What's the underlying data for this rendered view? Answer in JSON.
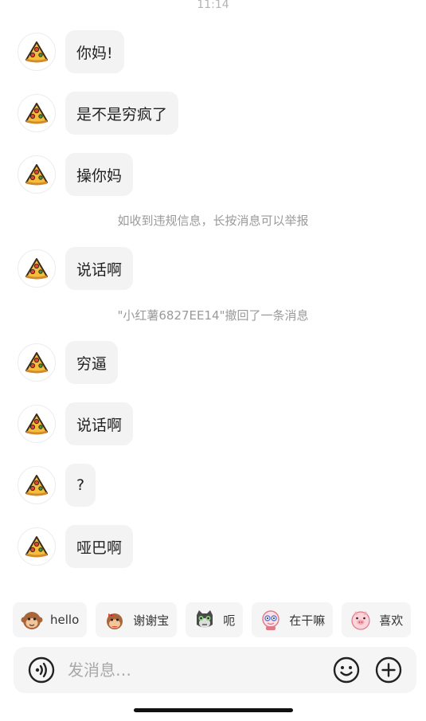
{
  "time": "11:14",
  "messages": [
    {
      "text": "你妈!"
    },
    {
      "text": "是不是穷疯了"
    },
    {
      "text": "操你妈"
    },
    {
      "text": "说话啊"
    },
    {
      "text": "穷逼"
    },
    {
      "text": "说话啊"
    },
    {
      "text": "?"
    },
    {
      "text": "哑巴啊"
    }
  ],
  "notices": {
    "report_hint": "如收到违规信息，长按消息可以举报",
    "recall": "\"小红薯6827EE14\"撤回了一条消息"
  },
  "quick_replies": [
    {
      "label": "hello",
      "icon": "monkey-sticker-icon"
    },
    {
      "label": "谢谢宝",
      "icon": "monkey-bow-sticker-icon"
    },
    {
      "label": "呃",
      "icon": "cat-sticker-icon"
    },
    {
      "label": "在干嘛",
      "icon": "doll-sticker-icon"
    },
    {
      "label": "喜欢",
      "icon": "pig-sticker-icon"
    }
  ],
  "input": {
    "placeholder": "发消息…",
    "left_icon": "voice-icon",
    "emoji_icon": "emoji-icon",
    "add_icon": "plus-icon"
  },
  "avatar_icon": "pizza-slice-icon"
}
